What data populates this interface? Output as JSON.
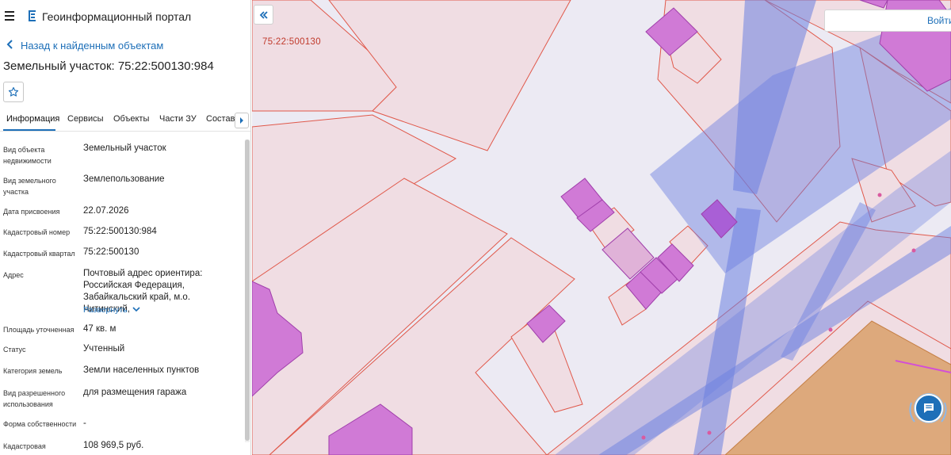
{
  "header": {
    "app_title": "Геоинформационный портал"
  },
  "nav": {
    "back_label": "Назад к найденным объектам"
  },
  "object": {
    "title": "Земельный участок: 75:22:500130:984"
  },
  "tabs": [
    {
      "label": "Информация",
      "active": true
    },
    {
      "label": "Сервисы",
      "active": false
    },
    {
      "label": "Объекты",
      "active": false
    },
    {
      "label": "Части ЗУ",
      "active": false
    },
    {
      "label": "Состав",
      "active": false
    }
  ],
  "properties": [
    {
      "label": "Вид объекта недвижимости",
      "value": "Земельный участок"
    },
    {
      "label": "Вид земельного участка",
      "value": "Землепользование"
    },
    {
      "label": "Дата присвоения",
      "value": "22.07.2026"
    },
    {
      "label": "Кадастровый номер",
      "value": "75:22:500130:984"
    },
    {
      "label": "Кадастровый квартал",
      "value": "75:22:500130"
    },
    {
      "label": "Адрес",
      "value": "Почтовый адрес ориентира: Российская Федерация, Забайкальский край, м.о. Читинский,"
    },
    {
      "label": "Площадь уточненная",
      "value": "47 кв. м"
    },
    {
      "label": "Статус",
      "value": "Учтенный"
    },
    {
      "label": "Категория земель",
      "value": "Земли населенных пунктов"
    },
    {
      "label": "Вид разрешенного использования",
      "value": "для размещения гаража"
    },
    {
      "label": "Форма собственности",
      "value": "-"
    },
    {
      "label": "Кадастровая",
      "value": "108 969,5 руб."
    }
  ],
  "address_expand_label": "Развернуть",
  "map": {
    "quarter_label": "75:22:500130",
    "login_label": "Войти"
  },
  "colors": {
    "accent": "#1d6fb8",
    "parcel_fill": "#f0dde3",
    "parcel_border": "#e0584a",
    "building_fill": "#d07ad6",
    "zone_blue": "#6b7fe0",
    "zone_orange": "#d9a06a"
  },
  "icons": {
    "menu": "hamburger-icon",
    "logo": "portal-logo-icon",
    "back": "chevron-left-icon",
    "favorite": "star-outline-icon",
    "tabs_next": "caret-right-icon",
    "collapse": "double-chevron-left-icon",
    "chat": "chat-bubble-icon"
  }
}
